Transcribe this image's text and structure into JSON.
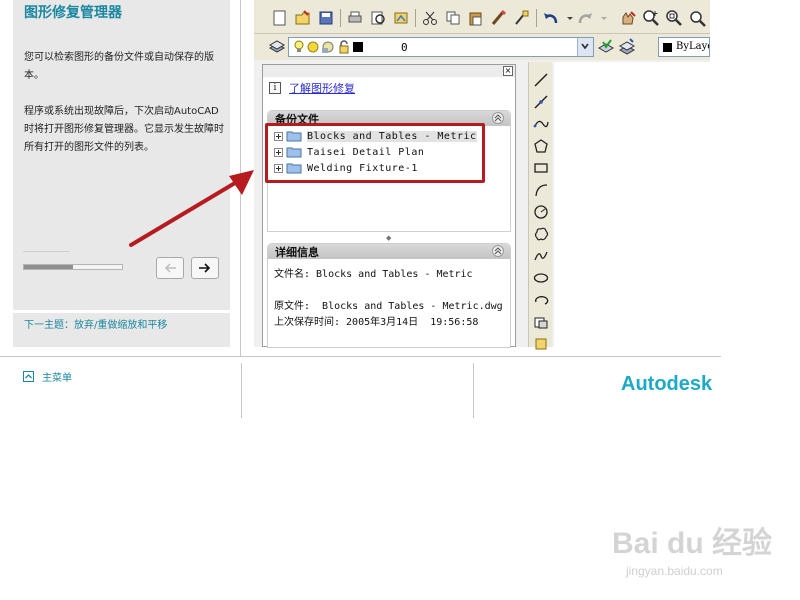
{
  "help": {
    "title": "图形修复管理器",
    "intro": "您可以检索图形的备份文件或自动保存的版本。",
    "body": "程序或系统出现故障后，下次启动AutoCAD 时将打开图形修复管理器。它显示发生故障时所有打开的图形文件的列表。",
    "progress_fraction": 0.5,
    "next_topic": "下一主题：放弃/重做缩放和平移",
    "home": "主菜单",
    "brand": "Autodesk"
  },
  "acad": {
    "layer_value": "0",
    "bylayer_text": "ByLaye",
    "info_link": "了解图形修复",
    "backup_section": {
      "title": "备份文件",
      "files": [
        "Blocks and Tables - Metric",
        "Taisei Detail Plan",
        "Welding Fixture-1"
      ]
    },
    "details_section": {
      "title": "详细信息",
      "filename_line": "文件名: Blocks and Tables - Metric",
      "original_line": "原文件:  Blocks and Tables - Metric.dwg",
      "saved_line": "上次保存时间: 2005年3月14日  19:56:58"
    }
  },
  "watermark": {
    "top": "Bai du 经验",
    "bottom": "jingyan.baidu.com"
  },
  "colors": {
    "accent": "#1b87a0",
    "annotation": "#b61b20",
    "panel_bg": "#e8e8e8"
  },
  "icons": [
    "info-icon",
    "folder-icon",
    "expand-plus-icon",
    "back-arrow-icon",
    "forward-arrow-icon",
    "home-icon",
    "close-icon",
    "collapse-icon"
  ]
}
